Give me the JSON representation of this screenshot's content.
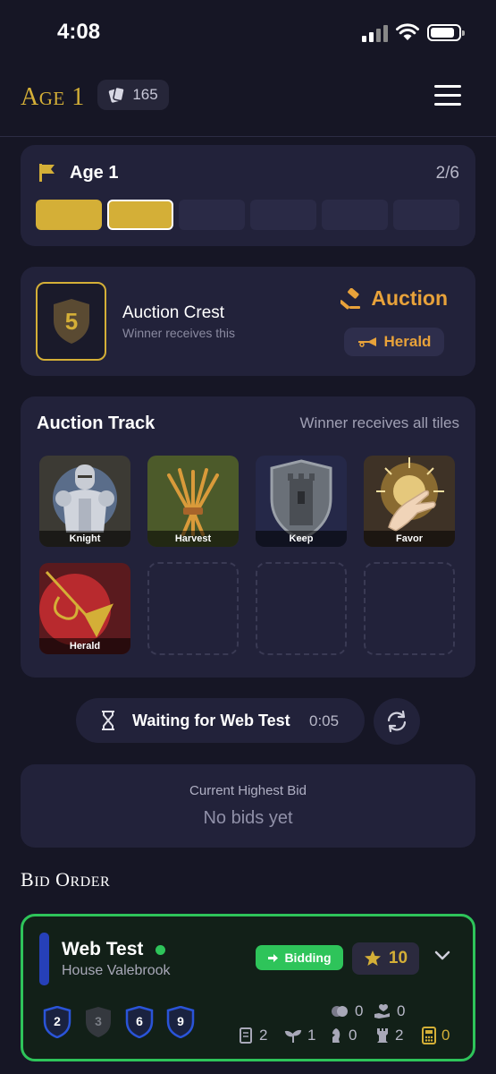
{
  "status_bar": {
    "time": "4:08"
  },
  "header": {
    "age_title_initial": "A",
    "age_title_rest": "GE",
    "age_number": "1",
    "card_count": "165"
  },
  "age_progress": {
    "label": "Age 1",
    "count": "2/6",
    "total_segments": 6,
    "completed": 2
  },
  "crest": {
    "value": "5",
    "title": "Auction Crest",
    "subtitle": "Winner receives this",
    "auction_label": "Auction",
    "herald_label": "Herald"
  },
  "auction_track": {
    "title": "Auction Track",
    "subtitle": "Winner receives all tiles",
    "tiles": [
      {
        "label": "Knight",
        "icon": "knight-armor-icon"
      },
      {
        "label": "Harvest",
        "icon": "wheat-sheaf-icon"
      },
      {
        "label": "Keep",
        "icon": "tower-shield-icon"
      },
      {
        "label": "Favor",
        "icon": "blessing-hand-icon"
      },
      {
        "label": "Herald",
        "icon": "trumpet-icon"
      }
    ]
  },
  "waiting": {
    "text": "Waiting for Web Test",
    "timer": "0:05"
  },
  "current_bid": {
    "label": "Current Highest Bid",
    "value": "No bids yet"
  },
  "bid_order": {
    "title_initial_1": "B",
    "title_rest_1": "ID",
    "title_initial_2": "O",
    "title_rest_2": "RDER"
  },
  "player": {
    "name": "Web Test",
    "house": "House Valebrook",
    "status": "Bidding",
    "score": "10",
    "shields": [
      "2",
      "3",
      "6",
      "9"
    ],
    "resources_top": [
      "0",
      "0"
    ],
    "resources_bottom": [
      "2",
      "1",
      "0",
      "2",
      "0"
    ]
  },
  "colors": {
    "accent_gold": "#d4af37",
    "orange": "#e8a23a",
    "active_green": "#2ec45a",
    "house_blue": "#2640b8"
  }
}
